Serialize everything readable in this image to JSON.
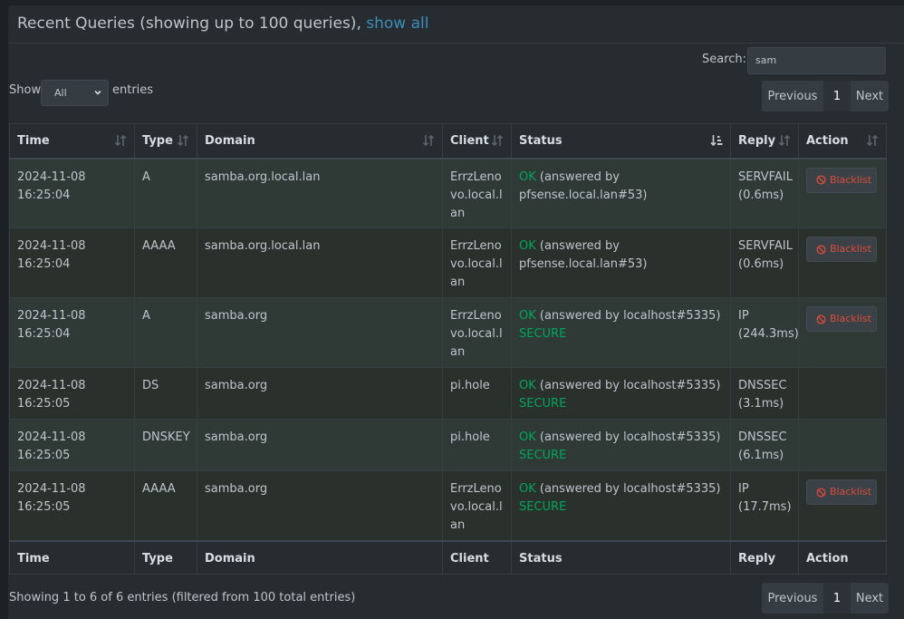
{
  "header": {
    "title": "Recent Queries (showing up to 100 queries), ",
    "show_all": "show all"
  },
  "search": {
    "label": "Search:",
    "value": "sam"
  },
  "length": {
    "show": "Show",
    "selected": "All",
    "entries": "entries"
  },
  "pager": {
    "previous": "Previous",
    "current": "1",
    "next": "Next"
  },
  "columns": [
    "Time",
    "Type",
    "Domain",
    "Client",
    "Status",
    "Reply",
    "Action"
  ],
  "rows": [
    {
      "time": "2024-11-08 16:25:04",
      "type": "A",
      "domain": "samba.org.local.lan",
      "client": "ErrzLenovo.local.lan",
      "status_ok": "OK",
      "status_text": " (answered by pfsense.local.lan#53)",
      "status_secure": "",
      "reply": "SERVFAIL (0.6ms)",
      "action": "Blacklist"
    },
    {
      "time": "2024-11-08 16:25:04",
      "type": "AAAA",
      "domain": "samba.org.local.lan",
      "client": "ErrzLenovo.local.lan",
      "status_ok": "OK",
      "status_text": " (answered by pfsense.local.lan#53)",
      "status_secure": "",
      "reply": "SERVFAIL (0.6ms)",
      "action": "Blacklist"
    },
    {
      "time": "2024-11-08 16:25:04",
      "type": "A",
      "domain": "samba.org",
      "client": "ErrzLenovo.local.lan",
      "status_ok": "OK",
      "status_text": " (answered by localhost#5335)",
      "status_secure": "SECURE",
      "reply": "IP (244.3ms)",
      "action": "Blacklist"
    },
    {
      "time": "2024-11-08 16:25:05",
      "type": "DS",
      "domain": "samba.org",
      "client": "pi.hole",
      "status_ok": "OK",
      "status_text": " (answered by localhost#5335)",
      "status_secure": "SECURE",
      "reply": "DNSSEC (3.1ms)",
      "action": ""
    },
    {
      "time": "2024-11-08 16:25:05",
      "type": "DNSKEY",
      "domain": "samba.org",
      "client": "pi.hole",
      "status_ok": "OK",
      "status_text": " (answered by localhost#5335)",
      "status_secure": "SECURE",
      "reply": "DNSSEC (6.1ms)",
      "action": ""
    },
    {
      "time": "2024-11-08 16:25:05",
      "type": "AAAA",
      "domain": "samba.org",
      "client": "ErrzLenovo.local.lan",
      "status_ok": "OK",
      "status_text": " (answered by localhost#5335)",
      "status_secure": "SECURE",
      "reply": "IP (17.7ms)",
      "action": "Blacklist"
    }
  ],
  "info": "Showing 1 to 6 of 6 entries (filtered from 100 total entries)",
  "colors": {
    "accent": "#3c8dbc",
    "ok": "#00a65a",
    "danger": "#dd4b39"
  },
  "icons": {
    "sort": "sort-icon",
    "sort_active": "sort-desc-icon",
    "blacklist": "ban-icon"
  }
}
